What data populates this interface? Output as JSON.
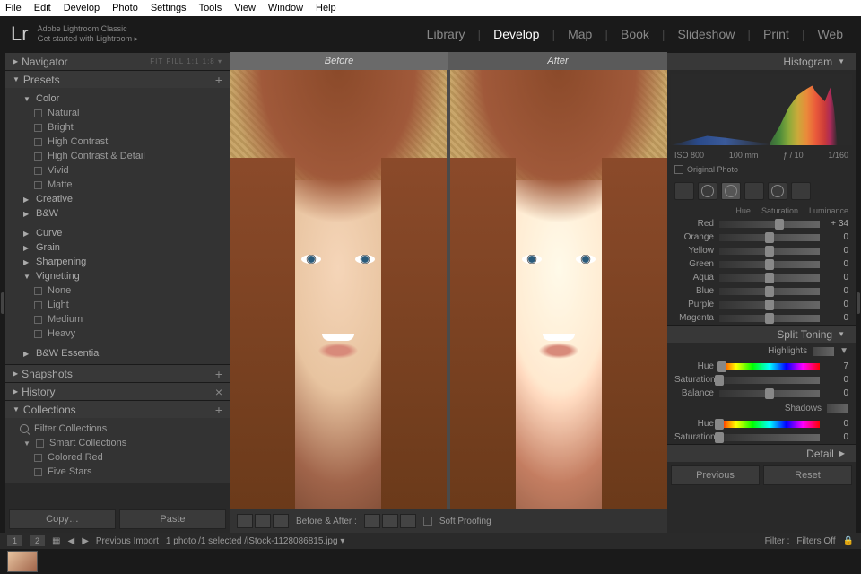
{
  "menu": [
    "File",
    "Edit",
    "Develop",
    "Photo",
    "Settings",
    "Tools",
    "View",
    "Window",
    "Help"
  ],
  "app_name": "Adobe Lightroom Classic",
  "tagline": "Get started with Lightroom ▸",
  "modules": [
    "Library",
    "Develop",
    "Map",
    "Book",
    "Slideshow",
    "Print",
    "Web"
  ],
  "active_module": "Develop",
  "left": {
    "navigator": "Navigator",
    "nav_opts": "FIT  FILL  1:1  1:8 ▾",
    "presets": "Presets",
    "tree": [
      {
        "t": "Color",
        "l": 1,
        "exp": true
      },
      {
        "t": "Natural",
        "l": 2
      },
      {
        "t": "Bright",
        "l": 2
      },
      {
        "t": "High Contrast",
        "l": 2
      },
      {
        "t": "High Contrast & Detail",
        "l": 2
      },
      {
        "t": "Vivid",
        "l": 2
      },
      {
        "t": "Matte",
        "l": 2
      },
      {
        "t": "Creative",
        "l": 1,
        "exp": false
      },
      {
        "t": "B&W",
        "l": 1,
        "exp": false
      },
      {
        "t": "",
        "l": 0,
        "spacer": true
      },
      {
        "t": "Curve",
        "l": 1,
        "exp": false
      },
      {
        "t": "Grain",
        "l": 1,
        "exp": false
      },
      {
        "t": "Sharpening",
        "l": 1,
        "exp": false
      },
      {
        "t": "Vignetting",
        "l": 1,
        "exp": true
      },
      {
        "t": "None",
        "l": 2
      },
      {
        "t": "Light",
        "l": 2
      },
      {
        "t": "Medium",
        "l": 2
      },
      {
        "t": "Heavy",
        "l": 2
      },
      {
        "t": "",
        "l": 0,
        "spacer": true
      },
      {
        "t": "B&W Essential",
        "l": 1,
        "exp": false
      }
    ],
    "snapshots": "Snapshots",
    "history": "History",
    "collections": "Collections",
    "filter_collections": "Filter Collections",
    "smart": "Smart Collections",
    "colored_red": "Colored Red",
    "five_stars": "Five Stars",
    "copy": "Copy…",
    "paste": "Paste"
  },
  "center": {
    "before": "Before",
    "after": "After",
    "ba_label": "Before & After :",
    "soft_proof": "Soft Proofing"
  },
  "right": {
    "histogram": "Histogram",
    "iso": "ISO 800",
    "focal": "100 mm",
    "fstop": "ƒ / 10",
    "shutter": "1/160",
    "orig": "Original Photo",
    "tabs": [
      "Hue",
      "Saturation",
      "Luminance"
    ],
    "sat_sliders": [
      {
        "name": "Red",
        "val": "+ 34",
        "pos": 60
      },
      {
        "name": "Orange",
        "val": "0",
        "pos": 50
      },
      {
        "name": "Yellow",
        "val": "0",
        "pos": 50
      },
      {
        "name": "Green",
        "val": "0",
        "pos": 50
      },
      {
        "name": "Aqua",
        "val": "0",
        "pos": 50
      },
      {
        "name": "Blue",
        "val": "0",
        "pos": 50
      },
      {
        "name": "Purple",
        "val": "0",
        "pos": 50
      },
      {
        "name": "Magenta",
        "val": "0",
        "pos": 50
      }
    ],
    "split_toning": "Split Toning",
    "highlights": "Highlights",
    "shadows": "Shadows",
    "st_h": [
      {
        "name": "Hue",
        "val": "7",
        "pos": 3
      },
      {
        "name": "Saturation",
        "val": "0",
        "pos": 0
      }
    ],
    "balance": {
      "name": "Balance",
      "val": "0",
      "pos": 50
    },
    "st_s": [
      {
        "name": "Hue",
        "val": "0",
        "pos": 0
      },
      {
        "name": "Saturation",
        "val": "0",
        "pos": 0
      }
    ],
    "detail": "Detail",
    "previous": "Previous",
    "reset": "Reset"
  },
  "footer": {
    "pages": [
      "1",
      "2"
    ],
    "prev_import": "Previous Import",
    "count": "1 photo /1 selected /iStock-1128086815.jpg ▾",
    "filter": "Filter :",
    "filters_off": "Filters Off"
  }
}
